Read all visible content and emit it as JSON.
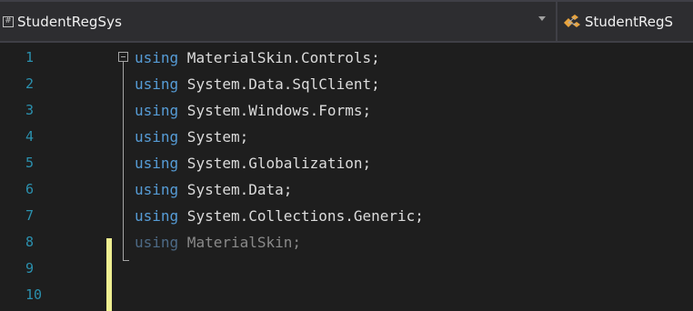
{
  "navbar": {
    "project_icon_glyph": "#",
    "project_name": "StudentRegSys",
    "class_name": "StudentRegS",
    "project_icon": "csharp-project-icon",
    "dropdown_icon": "chevron-down-icon",
    "class_icon": "class-icon"
  },
  "editor": {
    "lines": [
      {
        "number": "1",
        "keyword": "using",
        "namespace": " MaterialSkin.Controls;"
      },
      {
        "number": "2",
        "keyword": "using",
        "namespace": " System.Data.SqlClient;"
      },
      {
        "number": "3",
        "keyword": "using",
        "namespace": " System.Windows.Forms;"
      },
      {
        "number": "4",
        "keyword": "using",
        "namespace": " System;"
      },
      {
        "number": "5",
        "keyword": "using",
        "namespace": " System.Globalization;"
      },
      {
        "number": "6",
        "keyword": "using",
        "namespace": " System.Data;"
      },
      {
        "number": "7",
        "keyword": "using",
        "namespace": " System.Collections.Generic;"
      },
      {
        "number": "8",
        "keyword": "using",
        "namespace": " MaterialSkin;"
      },
      {
        "number": "9",
        "keyword": "",
        "namespace": ""
      },
      {
        "number": "10",
        "keyword": "",
        "namespace": ""
      }
    ]
  },
  "colors": {
    "background": "#1e1e1e",
    "line_number": "#2b91af",
    "keyword": "#569cd6",
    "identifier": "#dcdcdc",
    "unused_using": "#8a8a8a",
    "change_bar": "#efef91"
  }
}
